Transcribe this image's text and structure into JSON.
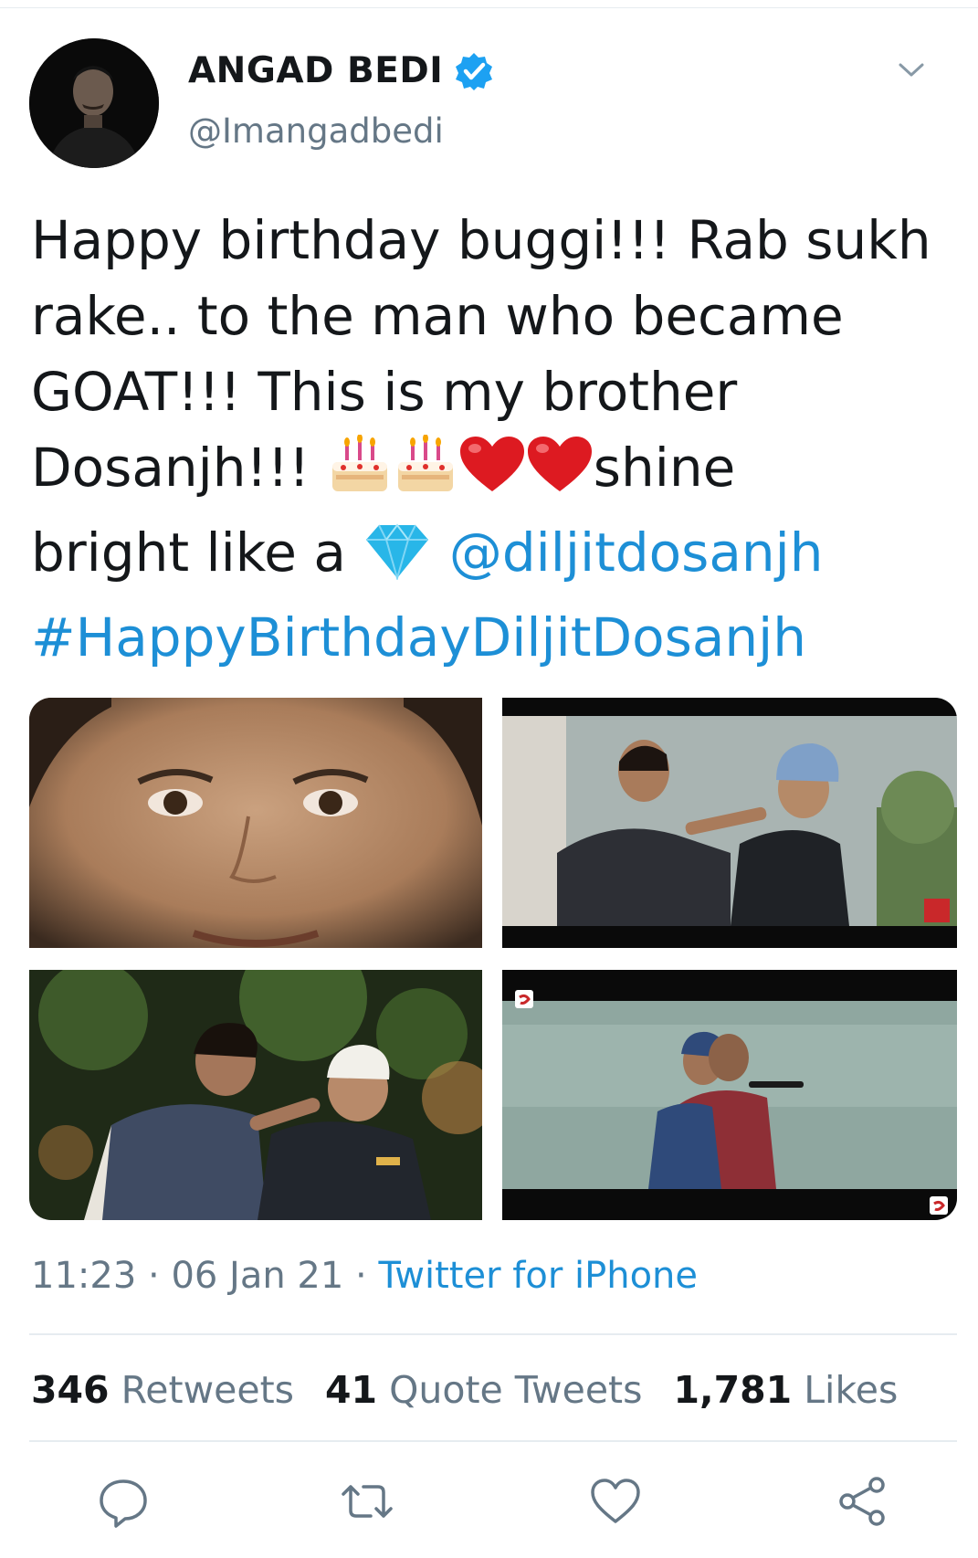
{
  "tweet": {
    "author": {
      "display_name": "ANGAD BEDI",
      "handle": "@Imangadbedi",
      "verified": true
    },
    "text": {
      "line1": "Happy birthday buggi!!! Rab sukh",
      "line2": "rake.. to the man who became",
      "line3": "GOAT!!! This is my brother",
      "line4_prefix": "Dosanjh!!! ",
      "line4_suffix": "shine",
      "line5_prefix": "bright like a ",
      "mention": "@diljitdosanjh",
      "hashtag": "#HappyBirthdayDiljitDosanjh"
    },
    "emojis": [
      "birthday-cake",
      "birthday-cake",
      "red-heart",
      "red-heart",
      "gem-stone"
    ],
    "photos": [
      "photo-1",
      "photo-2",
      "photo-3",
      "photo-4"
    ],
    "time": "11:23",
    "separator": " · ",
    "date": "06 Jan 21",
    "source": "Twitter for iPhone",
    "stats": {
      "retweets_count": "346",
      "retweets_label": "Retweets",
      "quotes_count": "41",
      "quotes_label": "Quote Tweets",
      "likes_count": "1,781",
      "likes_label": "Likes"
    },
    "actions": [
      "reply-icon",
      "retweet-icon",
      "like-icon",
      "share-icon"
    ]
  },
  "colors": {
    "link": "#1d8fd6",
    "secondary_text": "#657786",
    "divider": "#e6ecf0",
    "verified": "#1da1f2"
  }
}
